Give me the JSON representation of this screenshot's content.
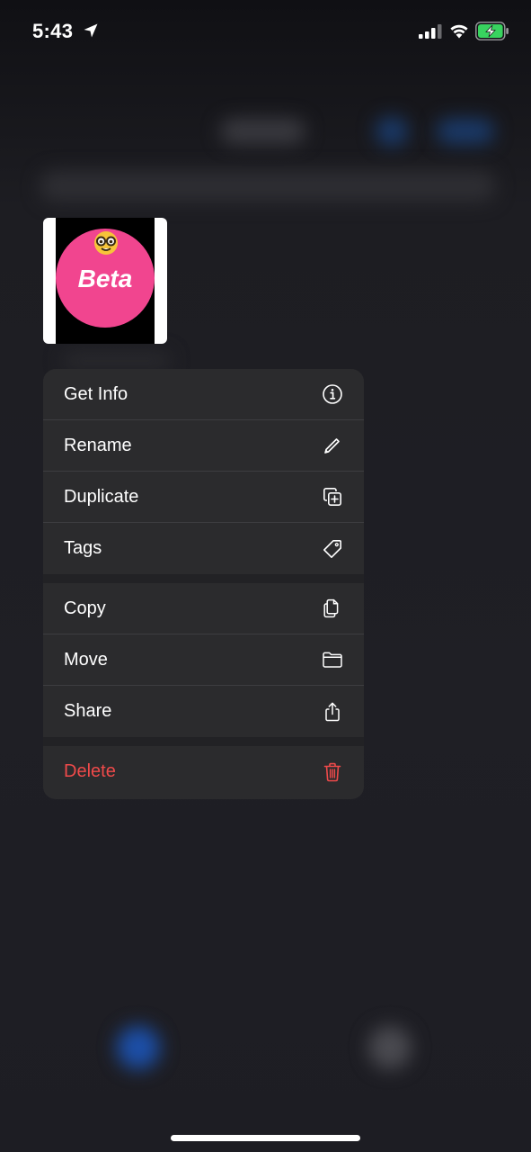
{
  "status_bar": {
    "time": "5:43",
    "icons": [
      "location-arrow-icon",
      "cellular-signal-icon",
      "wifi-icon",
      "battery-charging-icon"
    ],
    "battery_color": "#38d35f"
  },
  "thumbnail": {
    "text": "Beta",
    "emoji": "nerd-face-emoji",
    "circle_color": "#f1458f"
  },
  "context_menu": {
    "group1": [
      {
        "label": "Get Info",
        "icon": "info-circle-icon"
      },
      {
        "label": "Rename",
        "icon": "pencil-icon"
      },
      {
        "label": "Duplicate",
        "icon": "duplicate-icon"
      },
      {
        "label": "Tags",
        "icon": "tag-icon"
      }
    ],
    "group2": [
      {
        "label": "Copy",
        "icon": "copy-icon"
      },
      {
        "label": "Move",
        "icon": "folder-icon"
      },
      {
        "label": "Share",
        "icon": "share-icon"
      }
    ],
    "group3": [
      {
        "label": "Delete",
        "icon": "trash-icon",
        "color": "#ef4a4a"
      }
    ]
  },
  "colors": {
    "menu_background": "#2b2b2d",
    "destructive": "#ef4a4a",
    "accent_blue": "#1f6fe0"
  }
}
